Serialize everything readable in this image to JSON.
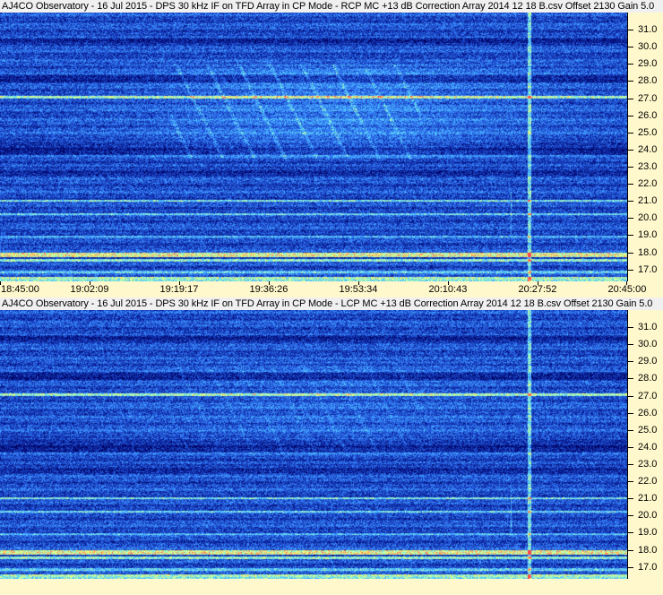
{
  "chart_data": [
    {
      "type": "heatmap",
      "title": "AJ4CO Observatory - 16 Jul 2015 - DPS 30 kHz IF on TFD Array in CP Mode - RCP  MC +13 dB  Correction Array 2014 12 18 B.csv  Offset 2130   Gain 5.0",
      "x_tick_labels": [
        "18:45:00",
        "19:02:09",
        "19:19:17",
        "19:36:26",
        "19:53:34",
        "20:10:43",
        "20:27:52",
        "20:45:00"
      ],
      "y_tick_labels": [
        "17.0",
        "18.0",
        "19.0",
        "20.0",
        "21.0",
        "22.0",
        "23.0",
        "24.0",
        "25.0",
        "26.0",
        "27.0",
        "28.0",
        "29.0",
        "30.0",
        "31.0"
      ],
      "ylim": [
        16.3,
        32.0
      ],
      "colormap": [
        "#00005a",
        "#0a1e96",
        "#1e50d2",
        "#3c8cff",
        "#50c8ff",
        "#a0ffc8",
        "#ffff64",
        "#ff4650"
      ]
    },
    {
      "type": "heatmap",
      "title": "AJ4CO Observatory - 16 Jul 2015 - DPS 30 kHz IF on TFD Array in CP Mode - LCP  MC +13 dB  Correction Array 2014 12 18 B.csv  Offset 2130   Gain 5.0",
      "x_tick_labels": [],
      "y_tick_labels": [
        "17.0",
        "18.0",
        "19.0",
        "20.0",
        "21.0",
        "22.0",
        "23.0",
        "24.0",
        "25.0",
        "26.0",
        "27.0",
        "28.0",
        "29.0",
        "30.0",
        "31.0"
      ],
      "ylim": [
        16.3,
        32.0
      ],
      "colormap": [
        "#00005a",
        "#0a1e96",
        "#1e50d2",
        "#3c8cff",
        "#50c8ff",
        "#a0ffc8",
        "#ffff64",
        "#ff4650"
      ]
    }
  ]
}
